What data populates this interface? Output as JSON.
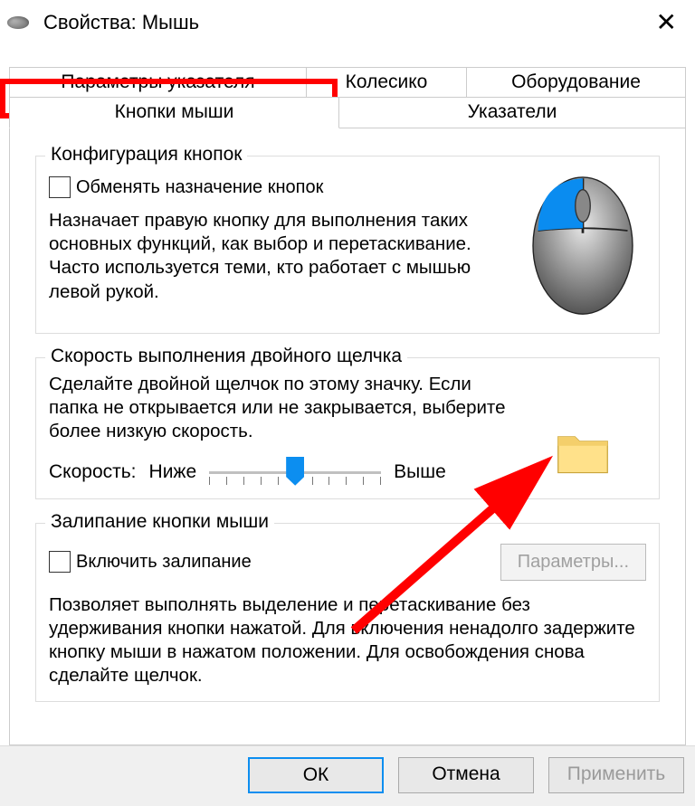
{
  "window": {
    "title": "Свойства: Мышь"
  },
  "tabs": {
    "row1": [
      "Параметры указателя",
      "Колесико",
      "Оборудование"
    ],
    "row2": [
      "Кнопки мыши",
      "Указатели"
    ],
    "active": "Кнопки мыши"
  },
  "group_buttons": {
    "title": "Конфигурация кнопок",
    "swap_label": "Обменять назначение кнопок",
    "swap_checked": false,
    "description": "Назначает правую кнопку для выполнения таких основных функций, как выбор и перетаскивание. Часто используется теми, кто работает с мышью левой рукой."
  },
  "group_speed": {
    "title": "Скорость выполнения двойного щелчка",
    "description": "Сделайте двойной щелчок по этому значку. Если папка не открывается или не закрывается, выберите более низкую скорость.",
    "speed_label": "Скорость:",
    "low_label": "Ниже",
    "high_label": "Выше"
  },
  "group_clicklock": {
    "title": "Залипание кнопки мыши",
    "enable_label": "Включить залипание",
    "enable_checked": false,
    "params_button": "Параметры...",
    "description": "Позволяет выполнять выделение и перетаскивание без удерживания кнопки нажатой. Для включения ненадолго задержите кнопку мыши в нажатом положении. Для освобождения снова сделайте щелчок."
  },
  "buttons": {
    "ok": "ОК",
    "cancel": "Отмена",
    "apply": "Применить"
  }
}
